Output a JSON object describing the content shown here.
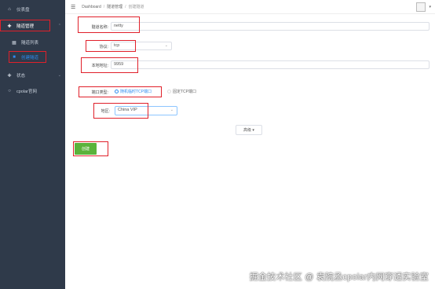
{
  "sidebar": {
    "items": [
      {
        "label": "仪表盘",
        "icon": "home-icon"
      },
      {
        "label": "隧道管理",
        "icon": "tunnel-icon"
      },
      {
        "label": "隧道列表",
        "icon": "list-icon"
      },
      {
        "label": "创建隧道",
        "icon": "create-icon"
      },
      {
        "label": "状态",
        "icon": "status-icon"
      },
      {
        "label": "cpolar官网",
        "icon": "link-icon"
      }
    ]
  },
  "header": {
    "menu_icon": "☰",
    "breadcrumb": [
      "Dashboard",
      "隧道管理",
      "创建隧道"
    ]
  },
  "form": {
    "name_label": "隧道名称:",
    "name_value": "netty",
    "protocol_label": "协议:",
    "protocol_value": "tcp",
    "local_addr_label": "本地地址:",
    "local_addr_value": "9959",
    "port_type_label": "端口类型:",
    "port_type_options": [
      "随机临时TCP端口",
      "固定TCP端口"
    ],
    "region_label": "地区:",
    "region_value": "China VIP",
    "advanced_label": "高级 ▾",
    "create_label": "创建"
  },
  "watermark": "掘金技术社区 @ 袁院丞cpolar内网穿透实验室",
  "colors": {
    "sidebar_bg": "#2f3a4a",
    "accent": "#2d8cf0",
    "create_button": "#5ab33b",
    "highlight": "#e0202a"
  }
}
